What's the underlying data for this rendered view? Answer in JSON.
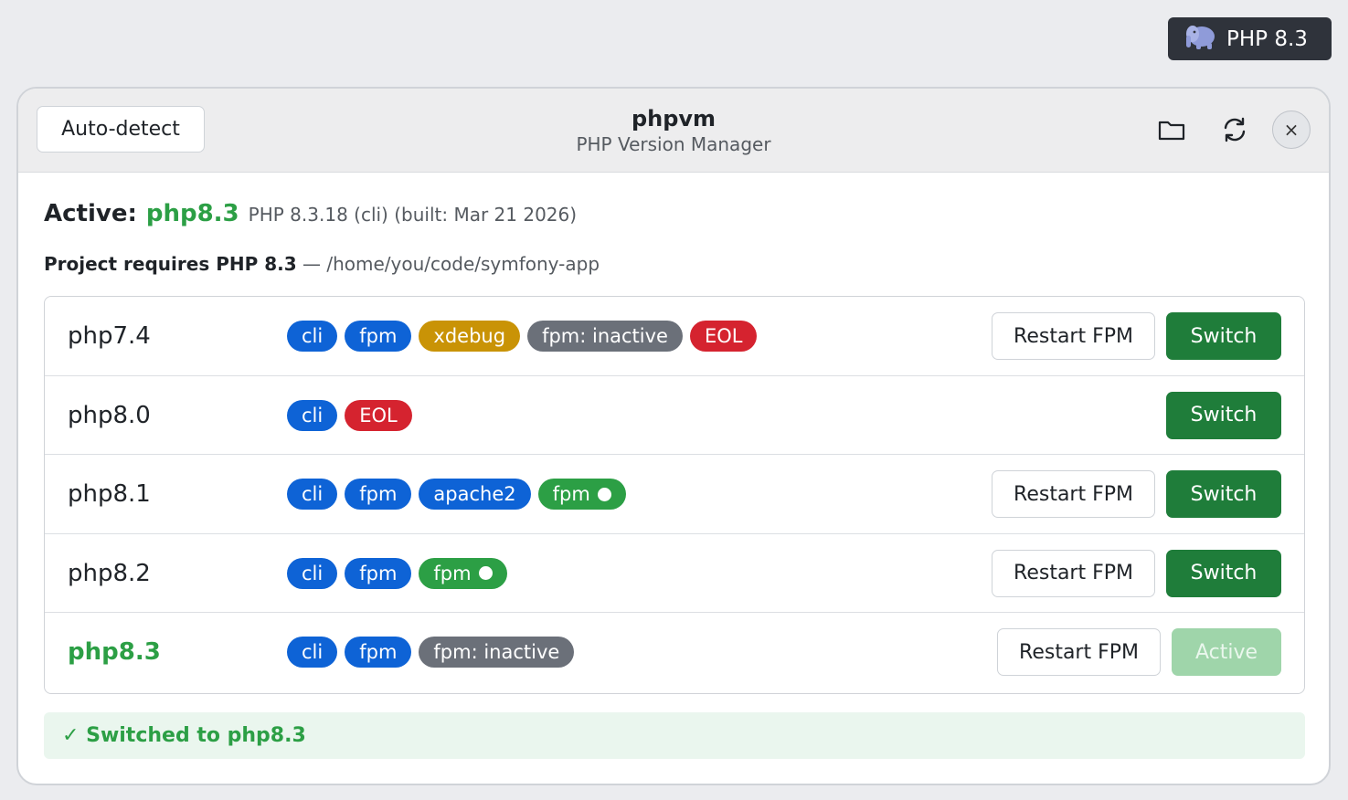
{
  "top_badge": {
    "label": "PHP 8.3",
    "icon": "elephant-icon"
  },
  "header": {
    "auto_detect_label": "Auto-detect",
    "title": "phpvm",
    "subtitle": "PHP Version Manager",
    "icons": [
      "folder-icon",
      "refresh-icon",
      "close-icon"
    ],
    "close_glyph": "×"
  },
  "active": {
    "label": "Active:",
    "version": "php8.3",
    "detail": "PHP 8.3.18 (cli) (built: Mar 21 2026)"
  },
  "project": {
    "requirement": "Project requires PHP 8.3",
    "separator": " — ",
    "path": "/home/you/code/symfony-app"
  },
  "versions": [
    {
      "name": "php7.4",
      "tags": [
        {
          "label": "cli",
          "color": "blue"
        },
        {
          "label": "fpm",
          "color": "blue"
        },
        {
          "label": "xdebug",
          "color": "gold"
        },
        {
          "label": "fpm: inactive",
          "color": "gray"
        },
        {
          "label": "EOL",
          "color": "red"
        }
      ],
      "restart_label": "Restart FPM",
      "action_label": "Switch"
    },
    {
      "name": "php8.0",
      "tags": [
        {
          "label": "cli",
          "color": "blue"
        },
        {
          "label": "EOL",
          "color": "red"
        }
      ],
      "action_label": "Switch"
    },
    {
      "name": "php8.1",
      "tags": [
        {
          "label": "cli",
          "color": "blue"
        },
        {
          "label": "fpm",
          "color": "blue"
        },
        {
          "label": "apache2",
          "color": "blue"
        },
        {
          "label": "fpm",
          "color": "green",
          "dot": true
        }
      ],
      "restart_label": "Restart FPM",
      "action_label": "Switch"
    },
    {
      "name": "php8.2",
      "tags": [
        {
          "label": "cli",
          "color": "blue"
        },
        {
          "label": "fpm",
          "color": "blue"
        },
        {
          "label": "fpm",
          "color": "green",
          "dot": true
        }
      ],
      "restart_label": "Restart FPM",
      "action_label": "Switch"
    },
    {
      "name": "php8.3",
      "current": true,
      "tags": [
        {
          "label": "cli",
          "color": "blue"
        },
        {
          "label": "fpm",
          "color": "blue"
        },
        {
          "label": "fpm: inactive",
          "color": "gray"
        }
      ],
      "restart_label": "Restart FPM",
      "action_label": "Active"
    }
  ],
  "status": {
    "message": "✓ Switched to php8.3"
  },
  "colors": {
    "accent_green": "#2c9f45",
    "switch_green": "#1f7d3a",
    "tag_blue": "#0e63d6",
    "tag_gold": "#c99306",
    "tag_gray": "#6b7079",
    "tag_red": "#d5232f"
  }
}
